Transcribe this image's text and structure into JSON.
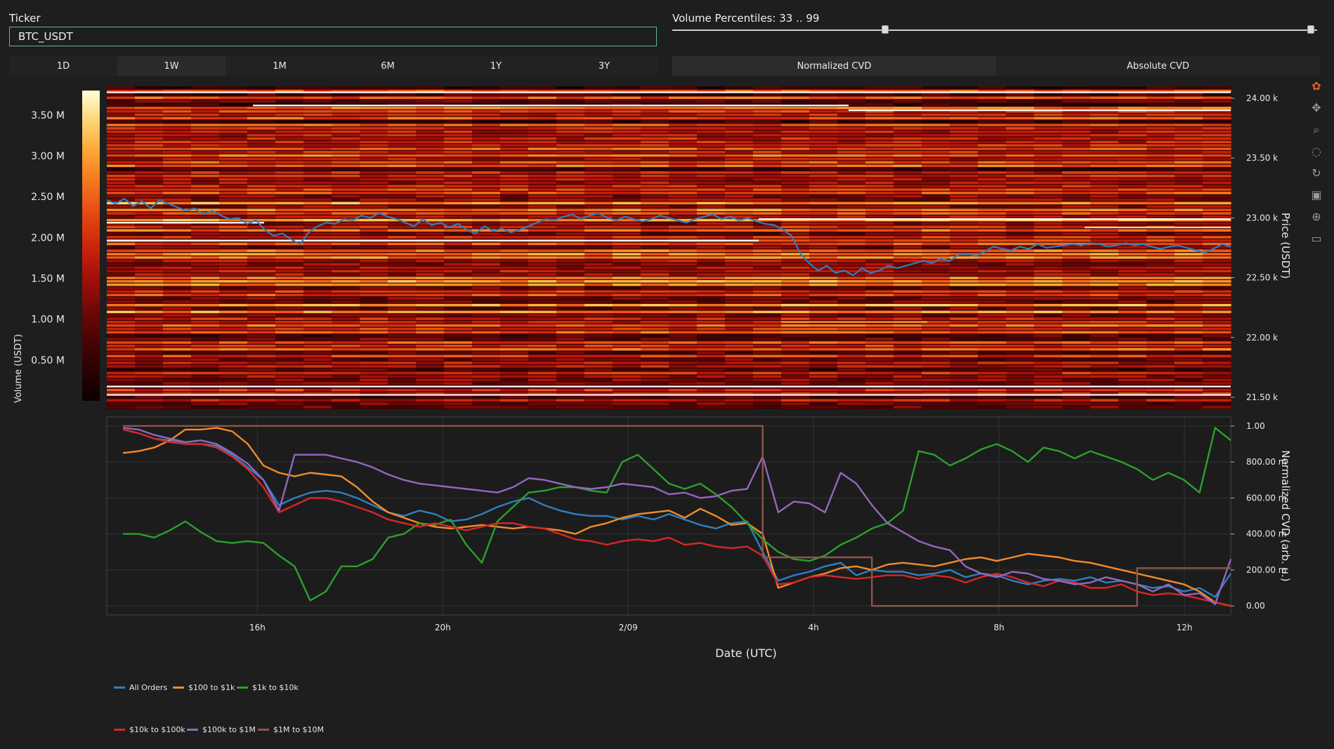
{
  "ticker": {
    "label": "Ticker",
    "value": "BTC_USDT"
  },
  "volume_percentiles": {
    "label": "Volume Percentiles: 33 .. 99",
    "min": 33,
    "max": 99,
    "low_fraction": 0.33,
    "high_fraction": 0.99
  },
  "time_ranges": [
    "1D",
    "1W",
    "1M",
    "6M",
    "1Y",
    "3Y"
  ],
  "time_range_active": "1W",
  "cvd_modes": [
    "Normalized CVD",
    "Absolute CVD"
  ],
  "cvd_mode_active": "Normalized CVD",
  "toolbar_icons": [
    "plotly-logo-icon",
    "pan-icon",
    "zoom-icon",
    "lasso-icon",
    "reset-icon",
    "save-icon",
    "spike-lines-icon",
    "hover-icon"
  ],
  "colors": {
    "background": "#1e1e1e",
    "plot_bg": "#1c1c1c",
    "price_line": "#2f7fc1",
    "input_border": "#5fb3a9"
  },
  "chart_data": [
    {
      "type": "heatmap",
      "title": "",
      "colorbar": {
        "label": "Volume (USDT)",
        "ticks": [
          "0.50 M",
          "1.00 M",
          "1.50 M",
          "2.00 M",
          "2.50 M",
          "3.00 M",
          "3.50 M"
        ],
        "range": [
          0,
          3.8
        ]
      },
      "ylabel": "Price (USDT)",
      "yticks": [
        "21.50 k",
        "22.00 k",
        "22.50 k",
        "23.00 k",
        "23.50 k",
        "24.00 k"
      ],
      "ylim": [
        21400,
        24100
      ],
      "price_series": {
        "name": "Price",
        "values": [
          23150,
          23120,
          23160,
          23100,
          23140,
          23080,
          23150,
          23120,
          23090,
          23060,
          23080,
          23030,
          23060,
          23020,
          22990,
          23000,
          22950,
          22980,
          22900,
          22850,
          22870,
          22820,
          22780,
          22880,
          22930,
          22960,
          22950,
          22990,
          22980,
          23020,
          23000,
          23040,
          23010,
          22990,
          22960,
          22930,
          22990,
          22940,
          22960,
          22920,
          22950,
          22900,
          22870,
          22930,
          22890,
          22910,
          22880,
          22900,
          22930,
          22960,
          22990,
          22980,
          23010,
          23030,
          22990,
          23020,
          23040,
          23000,
          22980,
          23010,
          22990,
          22970,
          22990,
          23020,
          23000,
          22980,
          22960,
          22990,
          23010,
          23030,
          22990,
          23010,
          22980,
          23000,
          22970,
          22950,
          22940,
          22900,
          22850,
          22700,
          22620,
          22560,
          22600,
          22540,
          22560,
          22520,
          22580,
          22540,
          22560,
          22600,
          22580,
          22600,
          22620,
          22640,
          22620,
          22660,
          22640,
          22690,
          22700,
          22680,
          22720,
          22760,
          22740,
          22730,
          22760,
          22740,
          22780,
          22750,
          22760,
          22770,
          22780,
          22770,
          22790,
          22780,
          22760,
          22770,
          22790,
          22770,
          22780,
          22760,
          22740,
          22760,
          22770,
          22750,
          22730,
          22710,
          22740,
          22780,
          22760
        ]
      },
      "lines_overlay": [
        {
          "price": 24050,
          "t0": 0.0,
          "t1": 1.0,
          "color": "#ffffff"
        },
        {
          "price": 23940,
          "t0": 0.13,
          "t1": 0.66,
          "color": "#ffffff"
        },
        {
          "price": 23900,
          "t0": 0.66,
          "t1": 1.0,
          "color": "#ffffff"
        },
        {
          "price": 22960,
          "t0": 0.0,
          "t1": 0.14,
          "color": "#ffffff"
        },
        {
          "price": 22810,
          "t0": 0.0,
          "t1": 0.58,
          "color": "#ffffff"
        },
        {
          "price": 22990,
          "t0": 0.58,
          "t1": 1.0,
          "color": "#ffffff"
        },
        {
          "price": 21590,
          "t0": 0.0,
          "t1": 1.0,
          "color": "#ffffff"
        },
        {
          "price": 21520,
          "t0": 0.0,
          "t1": 1.0,
          "color": "#ffffff"
        },
        {
          "price": 22130,
          "t0": 0.6,
          "t1": 0.73,
          "color": "#ff9a3a"
        },
        {
          "price": 22920,
          "t0": 0.87,
          "t1": 1.0,
          "color": "#ffd88a"
        }
      ]
    },
    {
      "type": "line",
      "title": "",
      "xlabel": "Date (UTC)",
      "ylabel": "Normalized CVD (arb. u.)",
      "xticks": [
        "16h",
        "20h",
        "2/09",
        "4h",
        "8h",
        "12h"
      ],
      "xtick_positions": [
        4,
        8,
        12,
        16,
        20,
        24
      ],
      "xlim": [
        0.75,
        25
      ],
      "yticks": [
        "0.00",
        "200.00 m",
        "400.00 m",
        "600.00 m",
        "800.00 m",
        "1.00"
      ],
      "ylim": [
        -0.05,
        1.05
      ],
      "legend_placement": "bottom-left",
      "series": [
        {
          "name": "All Orders",
          "color": "#2f7fc1",
          "values": [
            0.98,
            0.96,
            0.93,
            0.92,
            0.9,
            0.9,
            0.89,
            0.84,
            0.77,
            0.7,
            0.56,
            0.6,
            0.63,
            0.64,
            0.63,
            0.6,
            0.56,
            0.52,
            0.5,
            0.53,
            0.51,
            0.47,
            0.48,
            0.51,
            0.55,
            0.58,
            0.6,
            0.56,
            0.53,
            0.51,
            0.5,
            0.5,
            0.48,
            0.5,
            0.48,
            0.51,
            0.48,
            0.45,
            0.43,
            0.46,
            0.47,
            0.3,
            0.14,
            0.17,
            0.19,
            0.22,
            0.24,
            0.17,
            0.2,
            0.19,
            0.19,
            0.17,
            0.18,
            0.2,
            0.16,
            0.18,
            0.17,
            0.14,
            0.12,
            0.14,
            0.15,
            0.14,
            0.16,
            0.13,
            0.14,
            0.12,
            0.1,
            0.11,
            0.08,
            0.1,
            0.05,
            0.18
          ]
        },
        {
          "name": "$100 to $1k",
          "color": "#f28b2b",
          "values": [
            0.85,
            0.86,
            0.88,
            0.92,
            0.98,
            0.98,
            0.99,
            0.97,
            0.9,
            0.78,
            0.74,
            0.72,
            0.74,
            0.73,
            0.72,
            0.66,
            0.58,
            0.52,
            0.49,
            0.46,
            0.44,
            0.43,
            0.44,
            0.45,
            0.44,
            0.43,
            0.44,
            0.43,
            0.42,
            0.4,
            0.44,
            0.46,
            0.49,
            0.51,
            0.52,
            0.53,
            0.49,
            0.54,
            0.5,
            0.45,
            0.46,
            0.4,
            0.1,
            0.13,
            0.16,
            0.18,
            0.21,
            0.22,
            0.2,
            0.23,
            0.24,
            0.23,
            0.22,
            0.24,
            0.26,
            0.27,
            0.25,
            0.27,
            0.29,
            0.28,
            0.27,
            0.25,
            0.24,
            0.22,
            0.2,
            0.18,
            0.16,
            0.14,
            0.12,
            0.08,
            0.02,
            0.0
          ]
        },
        {
          "name": "$1k to $10k",
          "color": "#2ca02c",
          "values": [
            0.4,
            0.4,
            0.38,
            0.42,
            0.47,
            0.41,
            0.36,
            0.35,
            0.36,
            0.35,
            0.28,
            0.22,
            0.03,
            0.08,
            0.22,
            0.22,
            0.26,
            0.38,
            0.4,
            0.46,
            0.45,
            0.48,
            0.34,
            0.24,
            0.47,
            0.55,
            0.63,
            0.64,
            0.66,
            0.66,
            0.64,
            0.63,
            0.8,
            0.84,
            0.76,
            0.68,
            0.65,
            0.68,
            0.62,
            0.55,
            0.46,
            0.37,
            0.3,
            0.26,
            0.25,
            0.28,
            0.34,
            0.38,
            0.43,
            0.46,
            0.53,
            0.86,
            0.84,
            0.78,
            0.82,
            0.87,
            0.9,
            0.86,
            0.8,
            0.88,
            0.86,
            0.82,
            0.86,
            0.83,
            0.8,
            0.76,
            0.7,
            0.74,
            0.7,
            0.63,
            0.99,
            0.92
          ]
        },
        {
          "name": "$10k to $100k",
          "color": "#d62728",
          "values": [
            0.98,
            0.96,
            0.93,
            0.91,
            0.9,
            0.9,
            0.88,
            0.83,
            0.76,
            0.66,
            0.52,
            0.56,
            0.6,
            0.6,
            0.58,
            0.55,
            0.52,
            0.48,
            0.46,
            0.44,
            0.46,
            0.44,
            0.42,
            0.44,
            0.46,
            0.46,
            0.44,
            0.43,
            0.4,
            0.37,
            0.36,
            0.34,
            0.36,
            0.37,
            0.36,
            0.38,
            0.34,
            0.35,
            0.33,
            0.32,
            0.33,
            0.28,
            0.12,
            0.13,
            0.16,
            0.17,
            0.16,
            0.15,
            0.16,
            0.17,
            0.17,
            0.15,
            0.17,
            0.16,
            0.13,
            0.16,
            0.18,
            0.16,
            0.13,
            0.11,
            0.14,
            0.13,
            0.1,
            0.1,
            0.12,
            0.08,
            0.06,
            0.07,
            0.06,
            0.04,
            0.02,
            0.0
          ]
        },
        {
          "name": "$100k to $1M",
          "color": "#9467bd",
          "values": [
            0.99,
            0.98,
            0.95,
            0.93,
            0.91,
            0.92,
            0.9,
            0.85,
            0.79,
            0.7,
            0.53,
            0.84,
            0.84,
            0.84,
            0.82,
            0.8,
            0.77,
            0.73,
            0.7,
            0.68,
            0.67,
            0.66,
            0.65,
            0.64,
            0.63,
            0.66,
            0.71,
            0.7,
            0.68,
            0.66,
            0.65,
            0.66,
            0.68,
            0.67,
            0.66,
            0.62,
            0.63,
            0.6,
            0.61,
            0.64,
            0.65,
            0.83,
            0.52,
            0.58,
            0.57,
            0.52,
            0.74,
            0.68,
            0.56,
            0.46,
            0.41,
            0.36,
            0.33,
            0.31,
            0.22,
            0.18,
            0.16,
            0.19,
            0.18,
            0.15,
            0.14,
            0.12,
            0.13,
            0.16,
            0.14,
            0.12,
            0.08,
            0.12,
            0.06,
            0.07,
            0.01,
            0.26
          ]
        },
        {
          "name": "$1M to $10M",
          "color": "#8c564b",
          "values": [
            1.0,
            1.0,
            1.0,
            1.0,
            1.0,
            1.0,
            1.0,
            1.0,
            1.0,
            1.0,
            1.0,
            1.0,
            1.0,
            1.0,
            1.0,
            1.0,
            1.0,
            1.0,
            1.0,
            1.0,
            1.0,
            1.0,
            1.0,
            1.0,
            1.0,
            1.0,
            1.0,
            1.0,
            1.0,
            1.0,
            1.0,
            1.0,
            1.0,
            1.0,
            1.0,
            1.0,
            1.0,
            1.0,
            1.0,
            1.0,
            1.0,
            0.27,
            0.27,
            0.27,
            0.27,
            0.27,
            0.27,
            0.27,
            0.0,
            0.0,
            0.0,
            0.0,
            0.0,
            0.0,
            0.0,
            0.0,
            0.0,
            0.0,
            0.0,
            0.0,
            0.0,
            0.0,
            0.0,
            0.0,
            0.0,
            0.21,
            0.21,
            0.21,
            0.21,
            0.21,
            0.21,
            0.21
          ]
        }
      ]
    }
  ]
}
